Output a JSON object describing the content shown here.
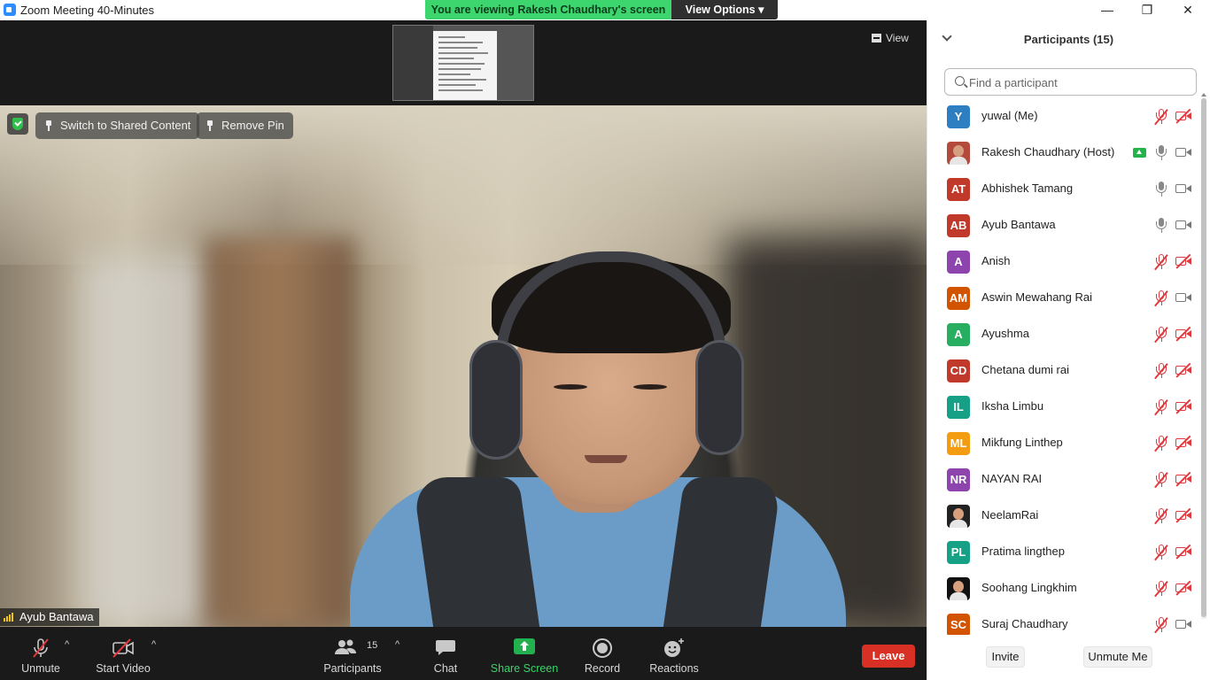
{
  "window": {
    "title": "Zoom Meeting 40-Minutes",
    "minimize": "—",
    "restore": "❐",
    "close": "✕"
  },
  "banner": {
    "message": "You are viewing Rakesh Chaudhary's screen",
    "view_options": "View Options ▾"
  },
  "stage": {
    "view_label": "View",
    "switch_label": "Switch to Shared Content",
    "remove_pin_label": "Remove Pin",
    "speaker_name": "Ayub Bantawa"
  },
  "toolbar": {
    "unmute": "Unmute",
    "start_video": "Start Video",
    "participants": "Participants",
    "participants_count": "15",
    "chat": "Chat",
    "share_screen": "Share Screen",
    "record": "Record",
    "reactions": "Reactions",
    "leave": "Leave",
    "caret": "^"
  },
  "panel": {
    "title": "Participants (15)",
    "search_placeholder": "Find a participant",
    "invite": "Invite",
    "unmute_me": "Unmute Me",
    "participants": [
      {
        "initials": "Y",
        "name": "yuwal (Me)",
        "color": "#2d7fc1",
        "mic": "off",
        "cam": "off"
      },
      {
        "initials": "",
        "name": "Rakesh Chaudhary (Host)",
        "color": "#b44a3c",
        "mic": "on",
        "cam": "on",
        "sharing": true,
        "photo": true
      },
      {
        "initials": "AT",
        "name": "Abhishek Tamang",
        "color": "#c0392b",
        "mic": "on",
        "cam": "on"
      },
      {
        "initials": "AB",
        "name": "Ayub Bantawa",
        "color": "#c0392b",
        "mic": "on",
        "cam": "on"
      },
      {
        "initials": "A",
        "name": "Anish",
        "color": "#8e44ad",
        "mic": "off",
        "cam": "off"
      },
      {
        "initials": "AM",
        "name": "Aswin Mewahang Rai",
        "color": "#d35400",
        "mic": "off",
        "cam": "on"
      },
      {
        "initials": "A",
        "name": "Ayushma",
        "color": "#27ae60",
        "mic": "off",
        "cam": "off"
      },
      {
        "initials": "CD",
        "name": "Chetana dumi rai",
        "color": "#c0392b",
        "mic": "off",
        "cam": "off"
      },
      {
        "initials": "IL",
        "name": "Iksha Limbu",
        "color": "#16a085",
        "mic": "off",
        "cam": "off"
      },
      {
        "initials": "ML",
        "name": "Mikfung Linthep",
        "color": "#f39c12",
        "mic": "off",
        "cam": "off"
      },
      {
        "initials": "NR",
        "name": "NAYAN RAI",
        "color": "#8e44ad",
        "mic": "off",
        "cam": "off"
      },
      {
        "initials": "",
        "name": "NeelamRai",
        "color": "#222222",
        "mic": "off",
        "cam": "off",
        "photo": true
      },
      {
        "initials": "PL",
        "name": "Pratima lingthep",
        "color": "#16a085",
        "mic": "off",
        "cam": "off"
      },
      {
        "initials": "",
        "name": "Soohang Lingkhim",
        "color": "#111111",
        "mic": "off",
        "cam": "off",
        "photo": true
      },
      {
        "initials": "SC",
        "name": "Suraj Chaudhary",
        "color": "#d35400",
        "mic": "off",
        "cam": "on"
      }
    ]
  }
}
